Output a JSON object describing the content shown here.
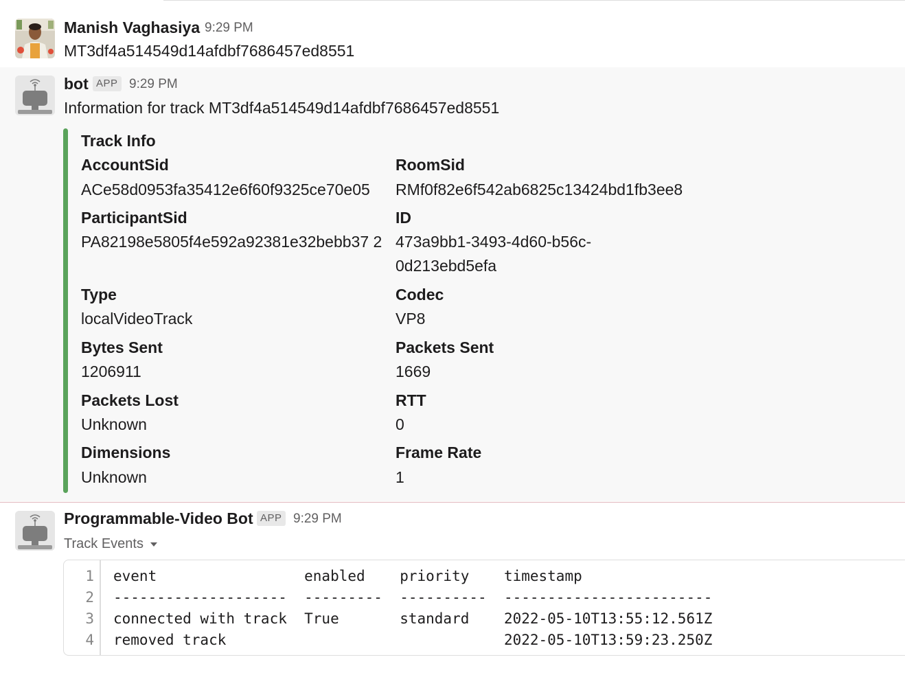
{
  "messages": [
    {
      "author": "Manish Vaghasiya",
      "time": "9:29 PM",
      "text": "MT3df4a514549d14afdbf7686457ed8551"
    },
    {
      "author": "bot",
      "badge": "APP",
      "time": "9:29 PM",
      "text": "Information for track MT3df4a514549d14afdbf7686457ed8551",
      "attachment": {
        "title": "Track Info",
        "accent_color": "#5aa35b",
        "fields": [
          {
            "label": "AccountSid",
            "value": "ACe58d0953fa35412e6f60f9325ce70e05"
          },
          {
            "label": "RoomSid",
            "value": "RMf0f82e6f542ab6825c13424bd1fb3ee8"
          },
          {
            "label": "ParticipantSid",
            "value": "PA82198e5805f4e592a92381e32bebb37 2"
          },
          {
            "label": "ID",
            "value": "473a9bb1-3493-4d60-b56c-0d213ebd5efa"
          },
          {
            "label": "Type",
            "value": "localVideoTrack"
          },
          {
            "label": "Codec",
            "value": "VP8"
          },
          {
            "label": "Bytes Sent",
            "value": "1206911"
          },
          {
            "label": "Packets Sent",
            "value": "1669"
          },
          {
            "label": "Packets Lost",
            "value": "Unknown"
          },
          {
            "label": "RTT",
            "value": "0"
          },
          {
            "label": "Dimensions",
            "value": "Unknown"
          },
          {
            "label": "Frame Rate",
            "value": "1"
          }
        ]
      }
    },
    {
      "author": "Programmable-Video Bot",
      "badge": "APP",
      "time": "9:29 PM",
      "dropdown_label": "Track Events",
      "code": {
        "line_numbers": [
          "1",
          "2",
          "3",
          "4"
        ],
        "lines": [
          "event                 enabled    priority    timestamp",
          "--------------------  ---------  ----------  ------------------------",
          "connected with track  True       standard    2022-05-10T13:55:12.561Z",
          "removed track                                2022-05-10T13:59:23.250Z"
        ]
      }
    }
  ]
}
